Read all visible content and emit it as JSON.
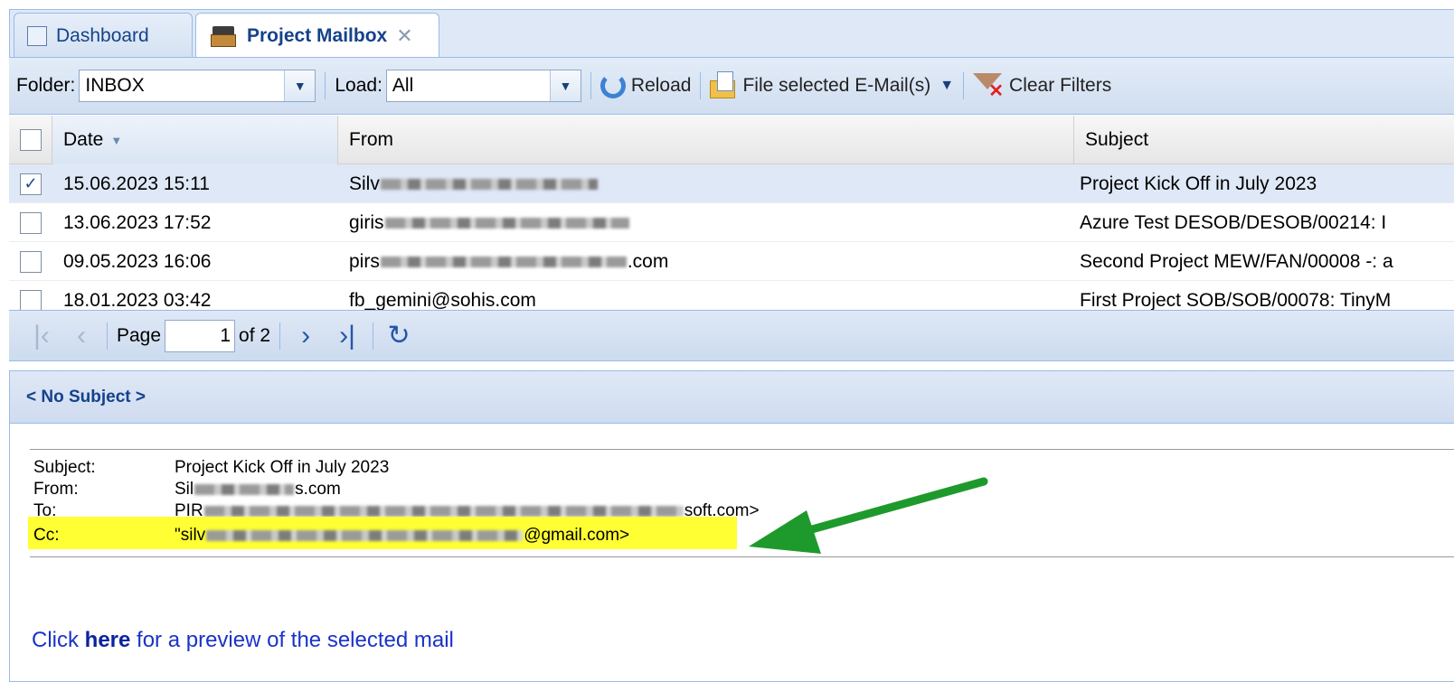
{
  "tabs": [
    {
      "label": "Dashboard"
    },
    {
      "label": "Project Mailbox"
    }
  ],
  "toolbar": {
    "folder_label": "Folder:",
    "folder_value": "INBOX",
    "load_label": "Load:",
    "load_value": "All",
    "reload_label": "Reload",
    "file_label": "File selected E-Mail(s)",
    "clear_label": "Clear Filters"
  },
  "grid": {
    "columns": [
      "Date",
      "From",
      "Subject"
    ],
    "rows": [
      {
        "date": "15.06.2023 15:11",
        "from": "Silv",
        "subject": "Project Kick Off in July 2023",
        "selected": true
      },
      {
        "date": "13.06.2023 17:52",
        "from": "giris",
        "subject": "Azure Test DESOB/DESOB/00214: I",
        "selected": false
      },
      {
        "date": "09.05.2023 16:06",
        "from": "pirs",
        "from_end": ".com",
        "subject": "Second Project MEW/FAN/00008 -: a",
        "selected": false
      },
      {
        "date": "18.01.2023 03:42",
        "from": "fb_gemini@sohis.com",
        "subject": "First Project SOB/SOB/00078: TinyM",
        "selected": false
      }
    ]
  },
  "paging": {
    "page_label": "Page",
    "page_value": "1",
    "of_label": "of 2"
  },
  "preview": {
    "title": "< No Subject >",
    "fields": {
      "subject_k": "Subject:",
      "subject_v": "Project Kick Off in July 2023",
      "from_k": "From:",
      "from_v_start": "Sil",
      "from_v_end": "s.com",
      "to_k": "To:",
      "to_v_start": "PIR",
      "to_v_end": "soft.com>",
      "cc_k": "Cc:",
      "cc_v_start": "\"silv",
      "cc_v_end": "@gmail.com>"
    },
    "link_pre": "Click ",
    "link_bold": "here",
    "link_post": " for a preview of the selected mail"
  },
  "colors": {
    "highlight": "#ffff33",
    "arrow": "#1e9a2c",
    "link": "#1a33c8"
  }
}
